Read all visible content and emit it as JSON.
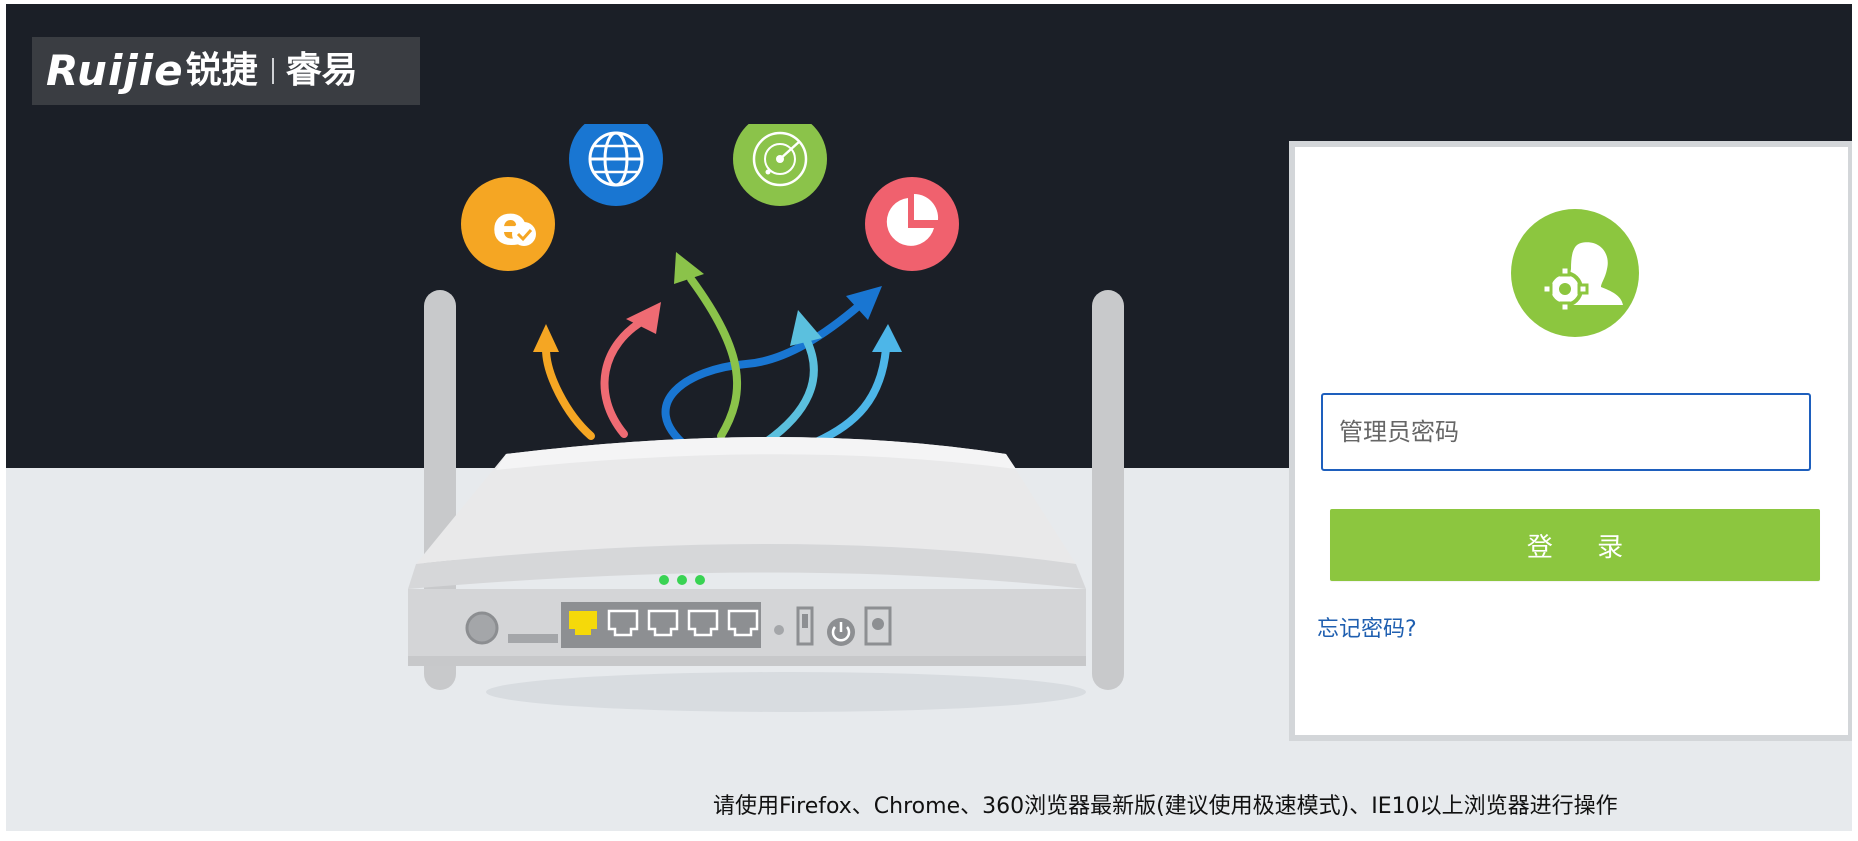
{
  "brand": {
    "latin": "Ruijie",
    "chinese": "锐捷",
    "product": "睿易"
  },
  "login": {
    "password_placeholder": "管理员密码",
    "password_value": "",
    "login_label": "登 录",
    "forgot_label": "忘记密码?"
  },
  "footer": {
    "browser_notice": "请使用Firefox、Chrome、360浏览器最新版(建议使用极速模式)、IE10以上浏览器进行操作"
  },
  "illustration": {
    "icons": [
      "ie-icon",
      "globe-icon",
      "radar-icon",
      "pie-chart-icon"
    ],
    "status_leds": 3,
    "lan_ports": 5
  },
  "colors": {
    "dark_band": "#1b1f27",
    "accent_green": "#8cc63f",
    "input_border": "#1e5fbd",
    "link_blue": "#1f5fb0",
    "ie_orange": "#f5a623",
    "globe_blue": "#1976d2",
    "radar_green": "#8bc34a",
    "pie_red": "#f0616e"
  }
}
